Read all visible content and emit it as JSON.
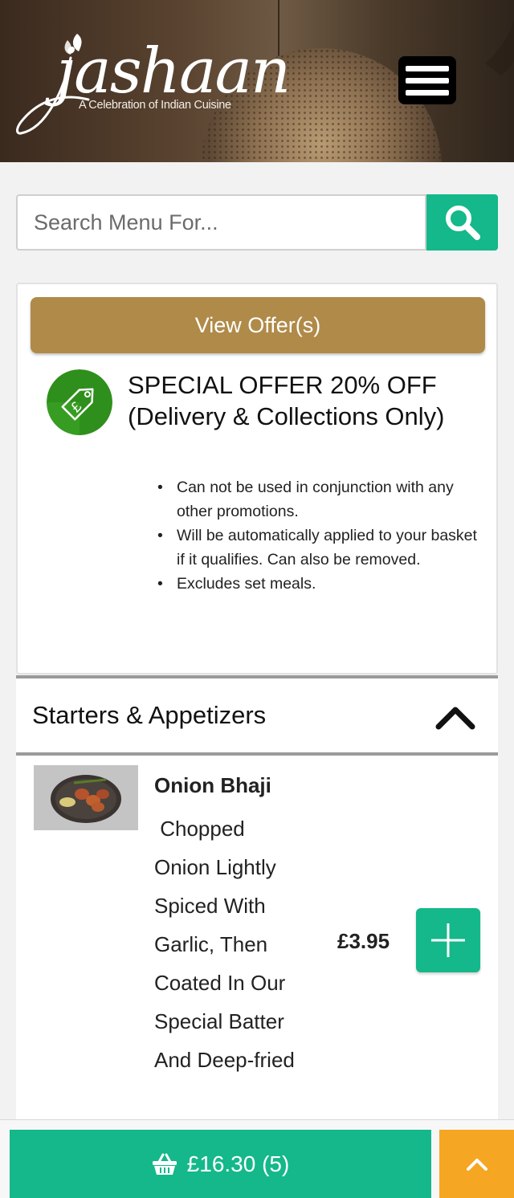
{
  "header": {
    "logo_text": "jashaan",
    "logo_subtitle": "A Celebration of Indian Cuisine",
    "menu_icon": "hamburger-menu-icon"
  },
  "search": {
    "placeholder": "Search Menu For...",
    "button_icon": "search-icon"
  },
  "offer": {
    "button_label": "View Offer(s)",
    "icon": "price-tag-pound-icon",
    "title": "SPECIAL OFFER 20% OFF (Delivery & Collections Only)",
    "terms": [
      "Can not be used in conjunction with any other promotions.",
      "Will be automatically applied to your basket if it qualifies. Can also be removed.",
      "Excludes set meals."
    ]
  },
  "category": {
    "title": "Starters & Appetizers",
    "toggle_icon": "chevron-up-icon"
  },
  "items": [
    {
      "name": "Onion Bhaji",
      "description": " Chopped Onion Lightly Spiced With Garlic, Then Coated In Our Special Batter And Deep-fried",
      "price": "£3.95",
      "add_icon": "plus-icon"
    }
  ],
  "basket": {
    "icon": "basket-icon",
    "label": "£16.30 (5)"
  },
  "scroll_top_icon": "chevron-up-icon",
  "colors": {
    "accent_green": "#14b88a",
    "offer_gold": "#b08a48",
    "scroll_orange": "#f5a623",
    "offer_icon_green": "#2f8f1c"
  }
}
